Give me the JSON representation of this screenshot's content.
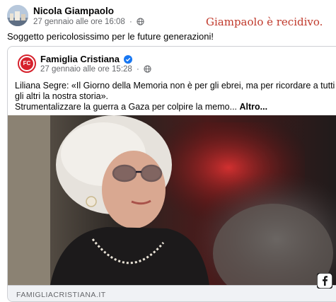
{
  "post": {
    "author": "Nicola Giampaolo",
    "timestamp": "27 gennaio alle ore 16:08",
    "separator": "·",
    "text": "Soggetto pericolosissimo per le future generazioni!"
  },
  "annotation": "Giampaolo è recidivo.",
  "shared": {
    "page_initials": "FC",
    "page_name": "Famiglia Cristiana",
    "timestamp": "27 gennaio alle ore 15:28",
    "separator": "·",
    "text_line1": "Liliana Segre: «Il Giorno della Memoria non è per gli ebrei, ma per ricordare a tutti gli altri la nostra storia».",
    "text_line2": "Strumentalizzare la guerra a Gaza per colpire la memo... ",
    "more_label": "Altro...",
    "link_domain": "FAMIGLIACRISTIANA.IT"
  },
  "icons": {
    "privacy": "globe-icon",
    "verified": "verified-badge-icon",
    "corner": "facebook-app-icon"
  },
  "colors": {
    "annotation": "#c0392b",
    "brand_red": "#d6222d",
    "verified_blue": "#1877f2",
    "secondary_text": "#65676b"
  }
}
